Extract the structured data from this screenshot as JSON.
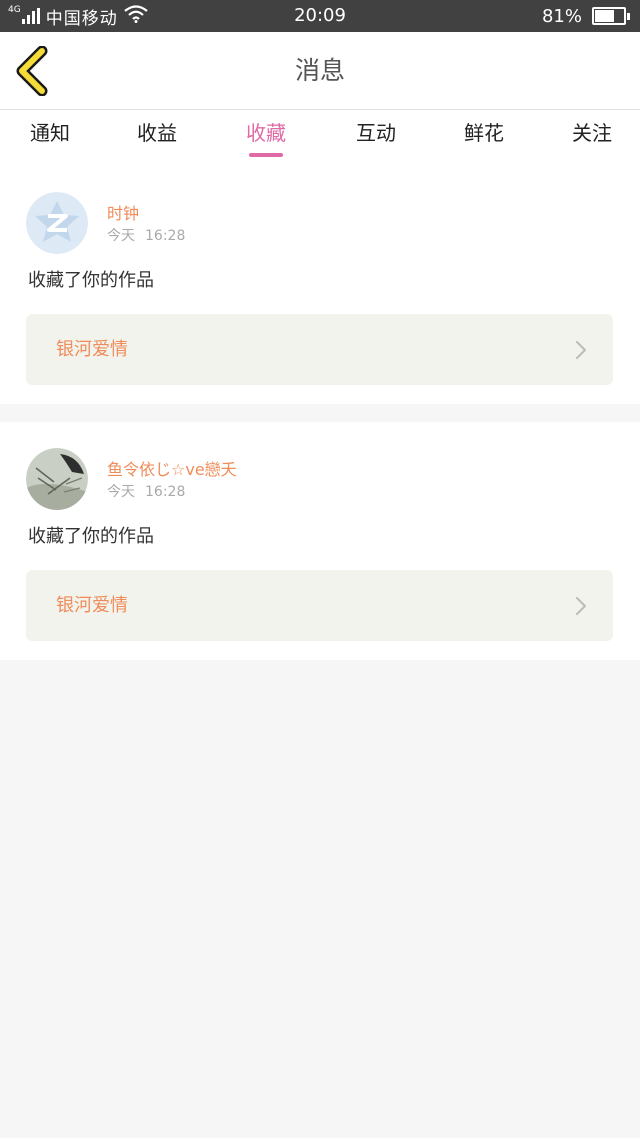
{
  "status_bar": {
    "network_type": "4G",
    "carrier": "中国移动",
    "time": "20:09",
    "battery_percent": "81%",
    "battery_level": 0.81
  },
  "header": {
    "title": "消息",
    "accent_color": "#e06aa6"
  },
  "tabs": [
    {
      "label": "通知",
      "active": false
    },
    {
      "label": "收益",
      "active": false
    },
    {
      "label": "收藏",
      "active": true
    },
    {
      "label": "互动",
      "active": false
    },
    {
      "label": "鲜花",
      "active": false
    },
    {
      "label": "关注",
      "active": false
    }
  ],
  "messages": [
    {
      "username": "时钟",
      "day": "今天",
      "time": "16:28",
      "action": "收藏了你的作品",
      "work_title": "银河爱情",
      "avatar_icon": "default-avatar-icon"
    },
    {
      "username": "鱼令依じ☆ve戀夭",
      "day": "今天",
      "time": "16:28",
      "action": "收藏了你的作品",
      "work_title": "银河爱情",
      "avatar_icon": "photo-avatar"
    }
  ],
  "colors": {
    "username": "#ef8c5a",
    "work_title": "#ef8c5a",
    "work_box_bg": "#f3f3ee",
    "back_arrow": "#f6dc36"
  }
}
